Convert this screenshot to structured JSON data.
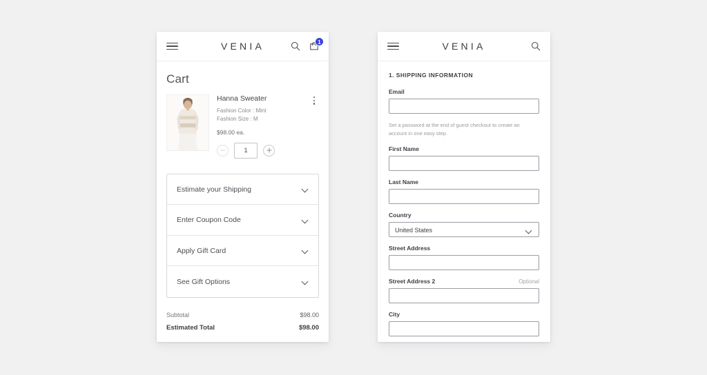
{
  "theme": {
    "background": "#f1f1f2",
    "panel": "#ffffff",
    "badge_accent": "#3544d6",
    "text_primary": "#3f3f45",
    "text_muted": "#8b8b92",
    "border": "#d8d8dd"
  },
  "cart_panel": {
    "header": {
      "menu_icon": "hamburger-icon",
      "brand": "VENIA",
      "search_icon": "search-icon",
      "cart_icon": "cart-icon",
      "cart_badge_count": "1"
    },
    "page_title": "Cart",
    "item": {
      "name": "Hanna Sweater",
      "options": [
        "Fashion Color : Mint",
        "Fashion Size : M"
      ],
      "price": "$98.00 ea.",
      "quantity": "1",
      "decrement_label": "−",
      "increment_label": "+",
      "menu_icon": "kebab-menu-icon",
      "thumbnail_alt": "model-wearing-mint-striped-sweater"
    },
    "accordion": [
      {
        "label": "Estimate your Shipping",
        "icon": "chevron-down-icon"
      },
      {
        "label": "Enter Coupon Code",
        "icon": "chevron-down-icon"
      },
      {
        "label": "Apply Gift Card",
        "icon": "chevron-down-icon"
      },
      {
        "label": "See Gift Options",
        "icon": "chevron-down-icon"
      }
    ],
    "totals": [
      {
        "label": "Subtotal",
        "value": "$98.00"
      },
      {
        "label": "Estimated Total",
        "value": "$98.00"
      }
    ]
  },
  "checkout_panel": {
    "header": {
      "menu_icon": "hamburger-icon",
      "brand": "VENIA",
      "search_icon": "search-icon"
    },
    "section_title": "1. SHIPPING INFORMATION",
    "email": {
      "label": "Email",
      "value": "",
      "placeholder": ""
    },
    "email_helper": "Set a password at the end of guest checkout to create an account in one easy step.",
    "first_name": {
      "label": "First Name",
      "value": "",
      "placeholder": ""
    },
    "last_name": {
      "label": "Last Name",
      "value": "",
      "placeholder": ""
    },
    "country": {
      "label": "Country",
      "value": "United States",
      "icon": "chevron-down-icon",
      "options": [
        "United States"
      ]
    },
    "street_address": {
      "label": "Street Address",
      "value": "",
      "placeholder": ""
    },
    "street_address_2": {
      "label": "Street Address 2",
      "optional_label": "Optional",
      "value": "",
      "placeholder": ""
    },
    "city": {
      "label": "City",
      "value": "",
      "placeholder": ""
    }
  }
}
